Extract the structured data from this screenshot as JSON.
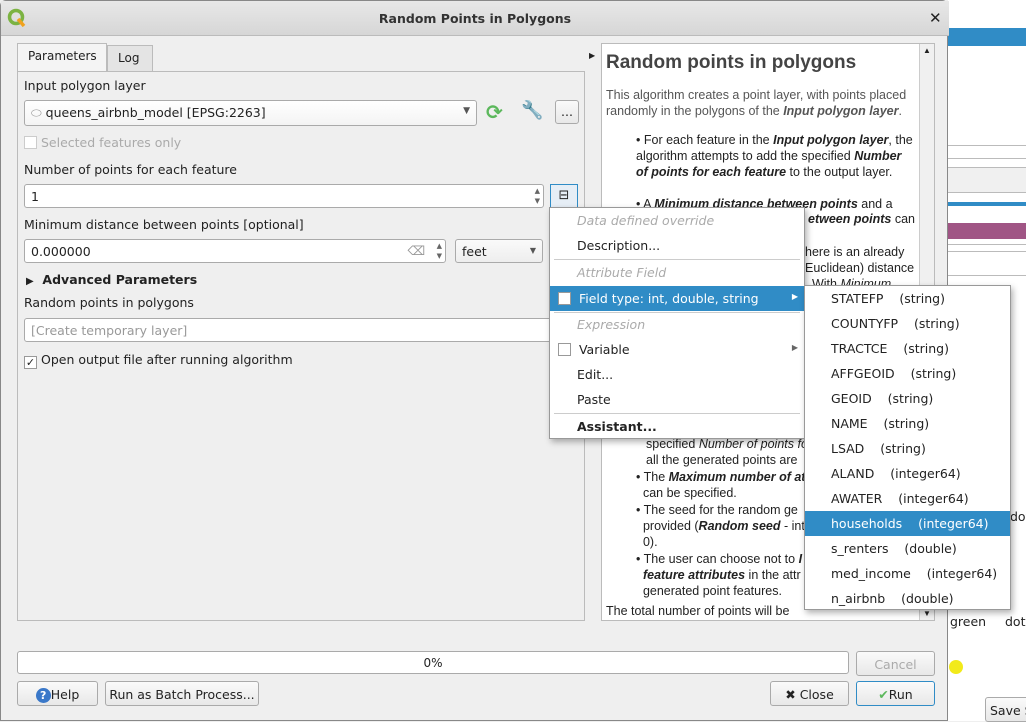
{
  "window": {
    "title": "Random Points in Polygons"
  },
  "tabs": [
    {
      "label": "Parameters",
      "active": true
    },
    {
      "label": "Log",
      "active": false
    }
  ],
  "params": {
    "input_label": "Input polygon layer",
    "input_value": "queens_airbnb_model [EPSG:2263]",
    "more_label": "...",
    "selected_only": "Selected features only",
    "npoints_label": "Number of points for each feature",
    "npoints_value": "1",
    "mindist_label": "Minimum distance between points [optional]",
    "mindist_value": "0.000000",
    "unit": "feet",
    "advanced": "Advanced Parameters",
    "output_label": "Random points in polygons",
    "output_placeholder": "[Create temporary layer]",
    "open_output": "Open output file after running algorithm",
    "open_output_checked": true
  },
  "help": {
    "title": "Random points in polygons",
    "intro_a": "This algorithm creates a point layer, with points placed randomly in the polygons of the ",
    "intro_b": "Input polygon layer",
    "l1": "For each feature in the ",
    "l1b": "Input polygon layer",
    "l1c": ", the algorithm attempts to add the specified ",
    "l1d": "Number of points for each feature",
    "l1e": " to the output layer.",
    "l2a": "A ",
    "l2b": "Minimum distance between points",
    "l2c": " and a",
    "l2d": "etween points",
    "l2e": " can",
    "l3a": "here is an already",
    "l3b": "Euclidean) distance",
    "l3c": "With ",
    "l3d": "Minimum",
    "l4a": "specified ",
    "l4b": "Number of points fo",
    "l4c": "all the generated points are",
    "l5a": "The ",
    "l5b": "Maximum number of at",
    "l5c": "can be specified.",
    "l6a": "The seed for the random ge",
    "l6b": "provided (",
    "l6c": "Random seed",
    "l6d": " - int",
    "l6e": "0).",
    "l7a": "The user can choose not to ",
    "l7b": "I",
    "l7c": "feature attributes",
    "l7d": " in the attr",
    "l7e": "generated point features.",
    "tail": "The total number of points will be"
  },
  "menu": {
    "items": [
      "Data defined override",
      "Description...",
      "Attribute Field",
      "Field type: int, double, string",
      "Expression",
      "Variable",
      "Edit...",
      "Paste",
      "Assistant..."
    ]
  },
  "submenu": {
    "fields": [
      {
        "name": "STATEFP",
        "type": "(string)"
      },
      {
        "name": "COUNTYFP",
        "type": "(string)"
      },
      {
        "name": "TRACTCE",
        "type": "(string)"
      },
      {
        "name": "AFFGEOID",
        "type": "(string)"
      },
      {
        "name": "GEOID",
        "type": "(string)"
      },
      {
        "name": "NAME",
        "type": "(string)"
      },
      {
        "name": "LSAD",
        "type": "(string)"
      },
      {
        "name": "ALAND",
        "type": "(integer64)"
      },
      {
        "name": "AWATER",
        "type": "(integer64)"
      },
      {
        "name": "households",
        "type": "(integer64)"
      },
      {
        "name": "s_renters",
        "type": "(double)"
      },
      {
        "name": "med_income",
        "type": "(integer64)"
      },
      {
        "name": "n_airbnb",
        "type": "(double)"
      }
    ],
    "selected": "households"
  },
  "footer": {
    "progress": "0%",
    "progress_value": 0,
    "cancel": "Cancel",
    "help": "Help",
    "batch": "Run as Batch Process...",
    "close": "Close",
    "run": "Run"
  },
  "background": {
    "green": "green",
    "dot1": "dot",
    "dot2": "dot",
    "save": "Save S"
  },
  "colors": {
    "accent": "#308cc6",
    "purple": "#a05585",
    "yellow": "#f2ea1a"
  }
}
